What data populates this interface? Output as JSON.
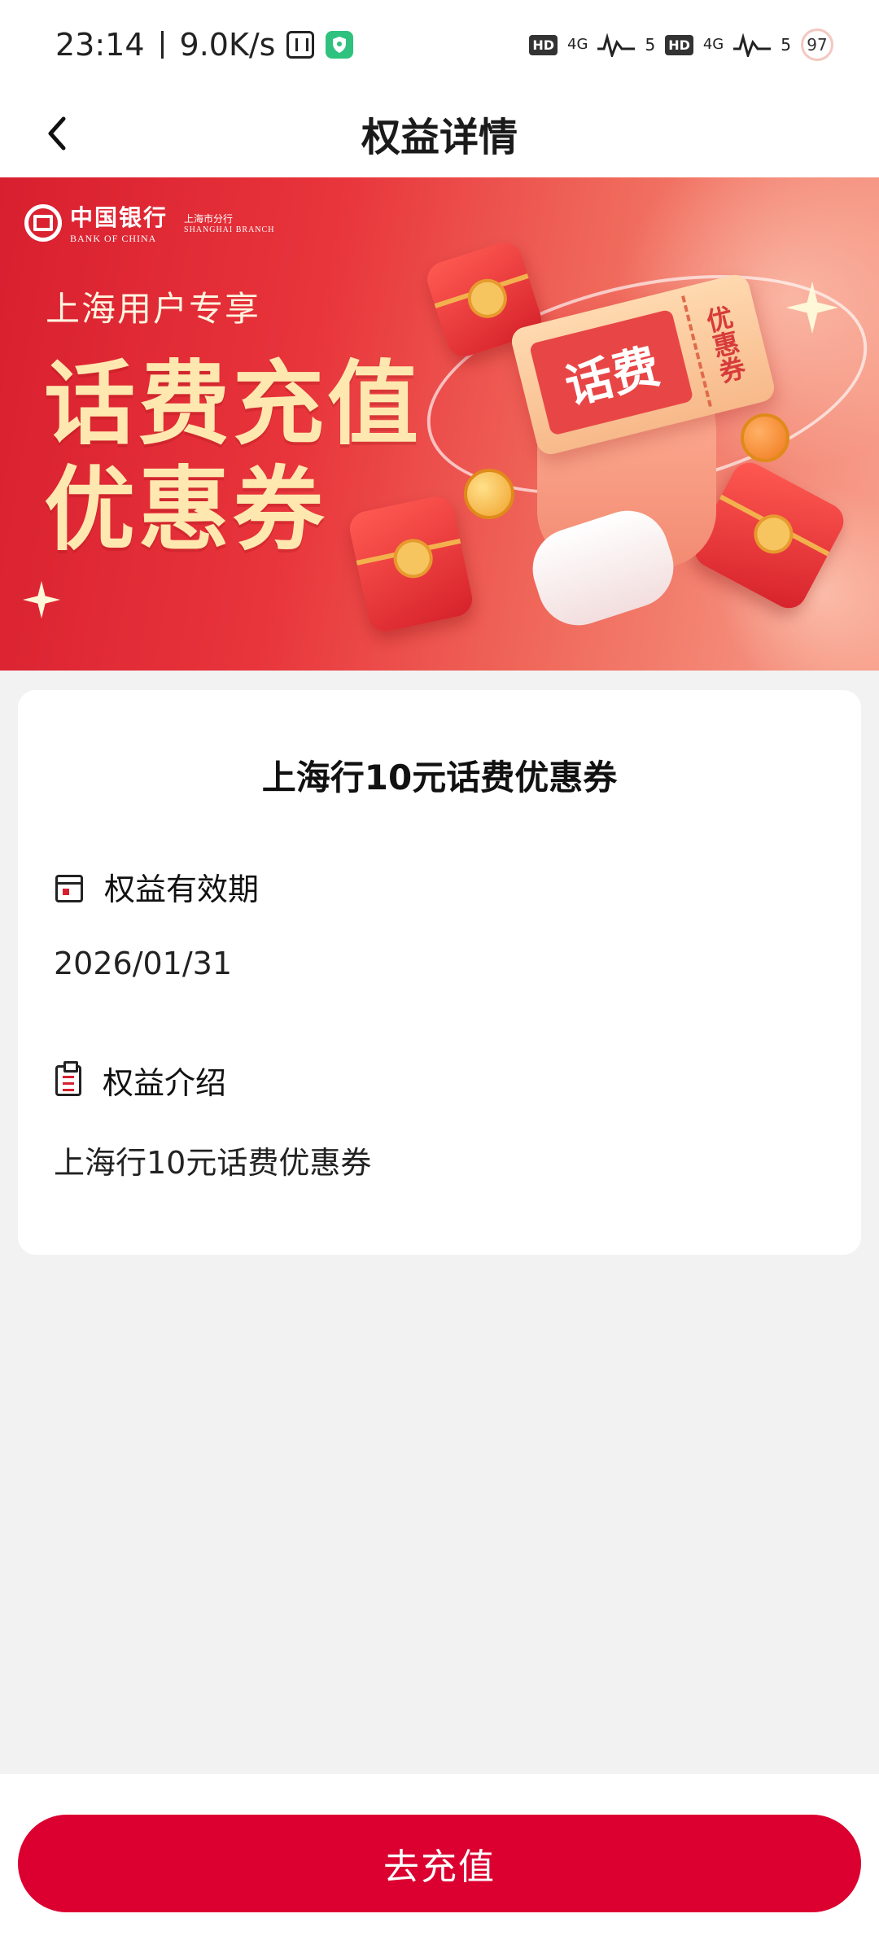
{
  "status_bar": {
    "time": "23:14",
    "net_speed": "9.0K/s",
    "hd_label": "HD",
    "signal_label": "4G",
    "signal_bars": "5",
    "battery": "97"
  },
  "header": {
    "title": "权益详情"
  },
  "banner": {
    "bank_name_cn": "中国银行",
    "bank_name_en": "BANK OF CHINA",
    "branch_cn": "上海市分行",
    "branch_en": "SHANGHAI BRANCH",
    "subtitle": "上海用户专享",
    "title_line1": "话费充值",
    "title_line2": "优惠券",
    "ticket_main": "话费",
    "ticket_side": "优惠券"
  },
  "card": {
    "title": "上海行10元话费优惠券",
    "validity_label": "权益有效期",
    "validity_value": "2026/01/31",
    "intro_label": "权益介绍",
    "intro_value": "上海行10元话费优惠券"
  },
  "actions": {
    "recharge_label": "去充值"
  },
  "colors": {
    "brand_red": "#db0030",
    "banner_red": "#d81f2f",
    "page_bg": "#f2f2f2"
  }
}
